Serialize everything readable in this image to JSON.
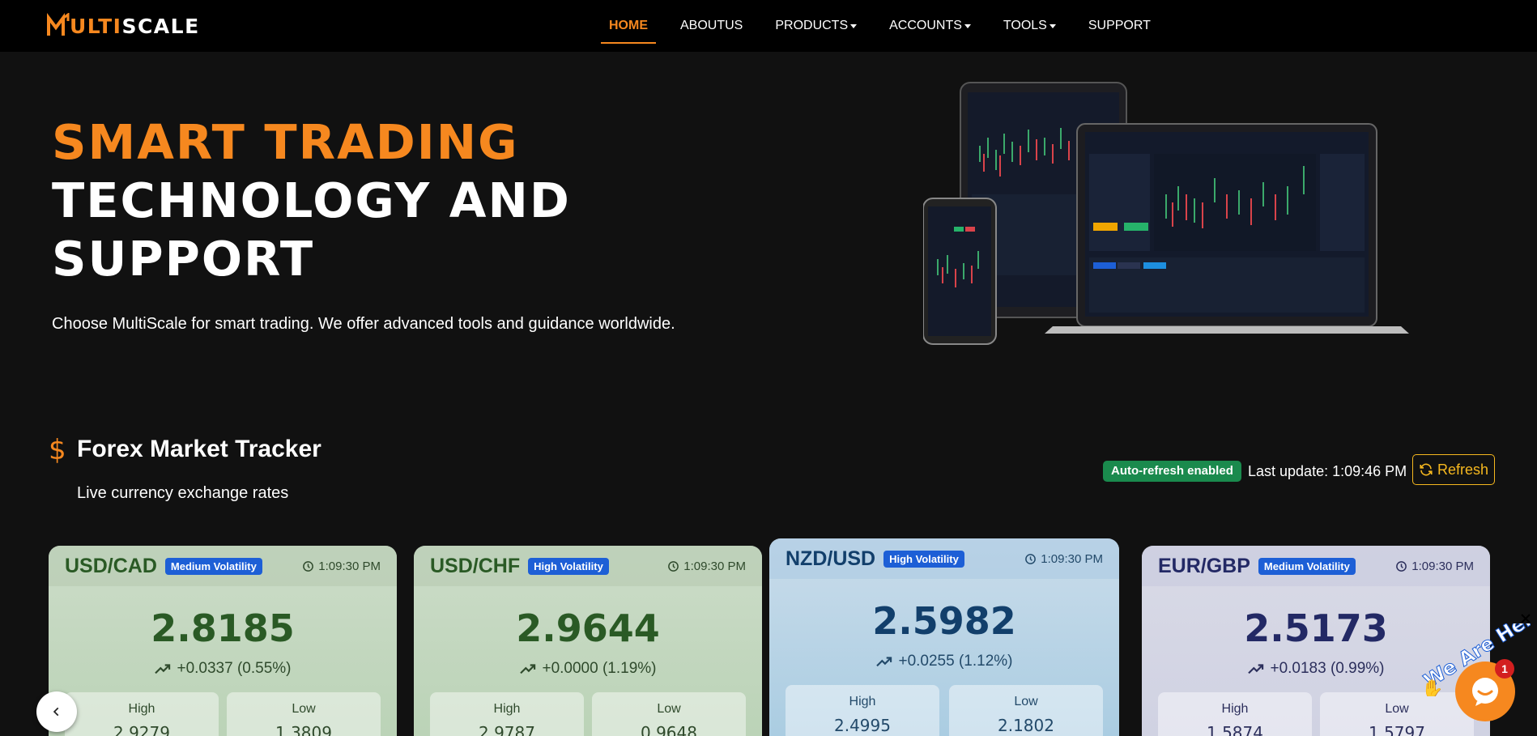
{
  "brand": {
    "logo_first": "M",
    "logo_ul": "ULTI",
    "logo_rest": "SCALE"
  },
  "nav": {
    "items": [
      {
        "label": "HOME",
        "active": true,
        "dropdown": false
      },
      {
        "label": "ABOUTUS",
        "active": false,
        "dropdown": false
      },
      {
        "label": "PRODUCTS",
        "active": false,
        "dropdown": true
      },
      {
        "label": "ACCOUNTS",
        "active": false,
        "dropdown": true
      },
      {
        "label": "TOOLS",
        "active": false,
        "dropdown": true
      },
      {
        "label": "SUPPORT",
        "active": false,
        "dropdown": false
      }
    ]
  },
  "hero": {
    "title_line1": "SMART TRADING",
    "title_line2": "TECHNOLOGY AND",
    "title_line3": "SUPPORT",
    "subtitle": "Choose MultiScale for smart trading. We offer advanced tools and guidance worldwide."
  },
  "tracker": {
    "icon": "dollar-icon",
    "title": "Forex Market Tracker",
    "subtitle": "Live currency exchange rates",
    "auto_refresh": "Auto-refresh enabled",
    "last_update": "Last update: 1:09:46 PM",
    "refresh_label": "Refresh"
  },
  "cards": [
    {
      "pair": "USD/CAD",
      "volatility": "Medium Volatility",
      "time": "1:09:30 PM",
      "price": "2.8185",
      "change": "+0.0337 (0.55%)",
      "high_label": "High",
      "high": "2.9279",
      "low_label": "Low",
      "low": "1.3809",
      "theme": "green"
    },
    {
      "pair": "USD/CHF",
      "volatility": "High Volatility",
      "time": "1:09:30 PM",
      "price": "2.9644",
      "change": "+0.0000 (1.19%)",
      "high_label": "High",
      "high": "2.9787",
      "low_label": "Low",
      "low": "0.9648",
      "theme": "green"
    },
    {
      "pair": "NZD/USD",
      "volatility": "High Volatility",
      "time": "1:09:30 PM",
      "price": "2.5982",
      "change": "+0.0255 (1.12%)",
      "high_label": "High",
      "high": "2.4995",
      "low_label": "Low",
      "low": "2.1802",
      "theme": "blue"
    },
    {
      "pair": "EUR/GBP",
      "volatility": "Medium Volatility",
      "time": "1:09:30 PM",
      "price": "2.5173",
      "change": "+0.0183 (0.99%)",
      "high_label": "High",
      "high": "1.5874",
      "low_label": "Low",
      "low": "1.5797",
      "theme": "purple"
    }
  ],
  "chat": {
    "tag": "We Are Here!",
    "badge": "1"
  },
  "colors": {
    "accent": "#f6881f",
    "badge_green": "#1a8a4d",
    "badge_blue": "#1d5fd6"
  }
}
